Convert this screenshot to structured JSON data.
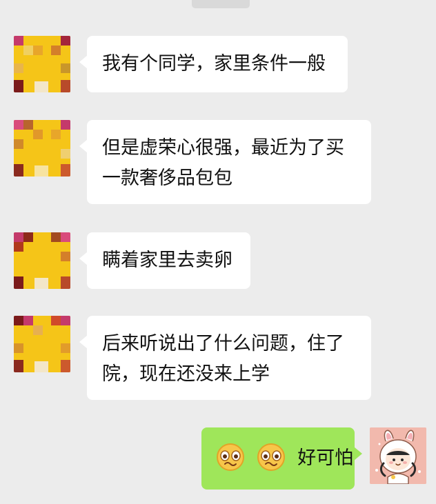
{
  "conversation": {
    "messages": [
      {
        "side": "left",
        "lines": [
          "我有个同学，家里条件一般"
        ]
      },
      {
        "side": "left",
        "lines": [
          "但是虚荣心很强，最近为了买",
          "一款奢侈品包包"
        ]
      },
      {
        "side": "left",
        "lines": [
          "瞒着家里去卖卵"
        ]
      },
      {
        "side": "left",
        "lines": [
          "后来听说出了什么问题，住了",
          "院，现在还没来上学"
        ]
      },
      {
        "side": "right",
        "emojis": [
          "woozy-face",
          "woozy-face"
        ],
        "text": "好可怕"
      }
    ]
  },
  "colors": {
    "background": "#ececec",
    "bubble_left": "#ffffff",
    "bubble_right": "#9fe65a"
  },
  "icons": {
    "left_avatar": "pixelated-avatar",
    "right_avatar": "bunny-hood-girl-avatar",
    "emoji": "woozy-face-emoji"
  }
}
